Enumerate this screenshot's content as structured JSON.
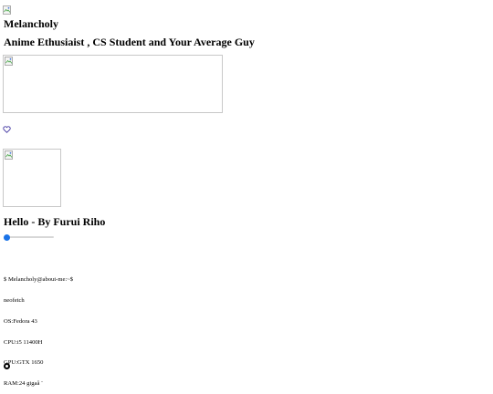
{
  "profile": {
    "name": "Melancholy",
    "tagline": "Anime Ethusiaist , CS Student and Your Average Guy"
  },
  "player": {
    "song": "Hello - By Furui Riho",
    "progress_fraction": 0.0
  },
  "terminal": {
    "lines": [
      "$ Melancholy@about-me:~$",
      "neofetch",
      "OS:Fedora 43",
      "CPU:i5 11400H",
      "GPU:GTX 1650",
      "RAM:24 gigaâ ¨"
    ]
  },
  "icons": {
    "like": "heart-outline-icon",
    "broken_image": "broken-image-icon",
    "playback": "record-button-icon"
  },
  "colors": {
    "heart": "#3b2f9e",
    "slider_knob": "#1a73e8"
  }
}
